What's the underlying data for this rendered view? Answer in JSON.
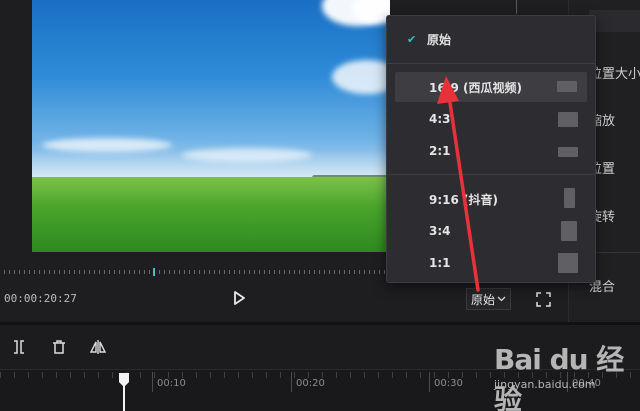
{
  "player": {
    "timecode": "00:00:20:27",
    "ratio_current": "原始",
    "scrub_progress": 0.4
  },
  "ratio_menu": {
    "items": [
      {
        "label": "原始",
        "selected": true,
        "shape": null
      },
      {
        "label": "16:9 (西瓜视频)",
        "hover": true,
        "shape": "landscape-16-9"
      },
      {
        "label": "4:3",
        "shape": "landscape-4-3"
      },
      {
        "label": "2:1",
        "shape": "landscape-2-1"
      },
      {
        "label": "9:16 (抖音)",
        "shape": "portrait-9-16"
      },
      {
        "label": "3:4",
        "shape": "portrait-3-4"
      },
      {
        "label": "1:1",
        "shape": "square-1-1"
      }
    ]
  },
  "inspector": {
    "labels": [
      "位置大小",
      "缩放",
      "位置",
      "旋转",
      "混合"
    ]
  },
  "timeline": {
    "ruler_labels": [
      "00:10",
      "00:20",
      "00:30",
      "00:40"
    ],
    "tools": [
      "split-icon",
      "delete-icon",
      "mirror-icon"
    ]
  },
  "watermark": {
    "logo": "Bai du 经验",
    "url": "jingyan.baidu.com"
  },
  "colors": {
    "accent": "#38c2c9",
    "annotation": "#e8323a",
    "panel_bg": "#2d2d31"
  }
}
